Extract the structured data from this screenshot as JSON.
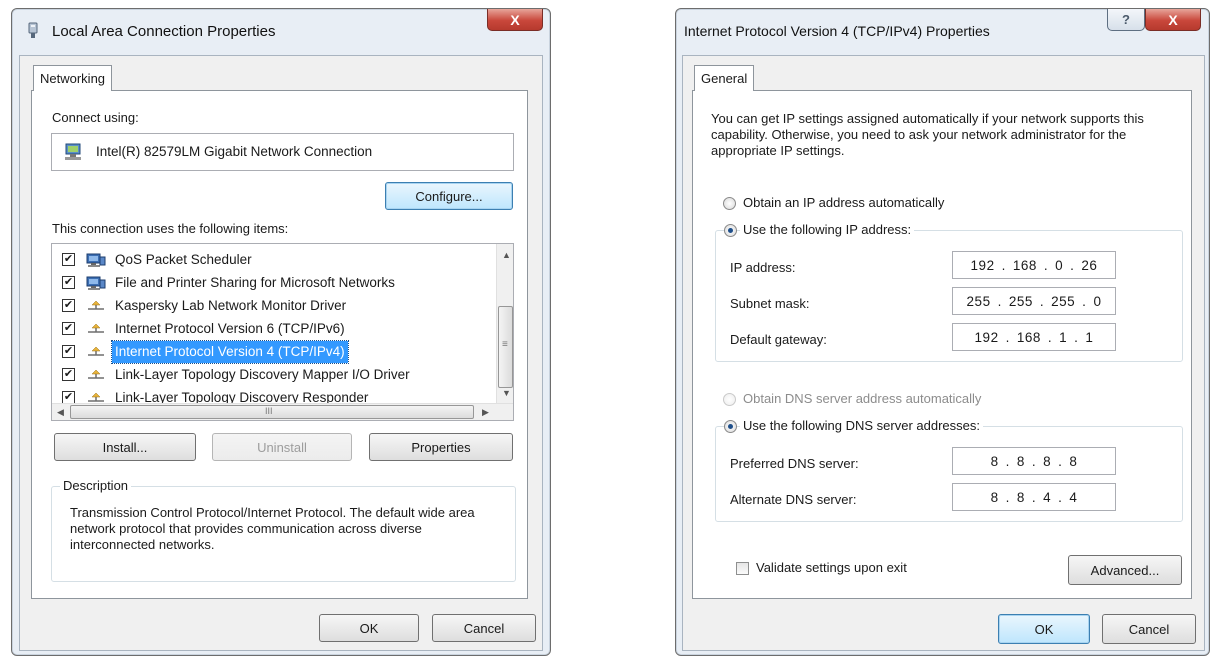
{
  "left_dialog": {
    "title": "Local Area Connection Properties",
    "title_icon": "network-connection-icon",
    "close_glyph": "X",
    "tab": "Networking",
    "connect_using_label": "Connect using:",
    "adapter_name": "Intel(R) 82579LM Gigabit Network Connection",
    "adapter_icon": "network-adapter-icon",
    "configure_button": "Configure...",
    "items_label": "This connection uses the following items:",
    "items": [
      {
        "label": "QoS Packet Scheduler",
        "checked": true,
        "icon": "network-service-icon",
        "selected": false
      },
      {
        "label": "File and Printer Sharing for Microsoft Networks",
        "checked": true,
        "icon": "network-service-icon",
        "selected": false
      },
      {
        "label": "Kaspersky Lab Network Monitor Driver",
        "checked": true,
        "icon": "protocol-icon",
        "selected": false
      },
      {
        "label": "Internet Protocol Version 6 (TCP/IPv6)",
        "checked": true,
        "icon": "protocol-icon",
        "selected": false
      },
      {
        "label": "Internet Protocol Version 4 (TCP/IPv4)",
        "checked": true,
        "icon": "protocol-icon",
        "selected": true
      },
      {
        "label": "Link-Layer Topology Discovery Mapper I/O Driver",
        "checked": true,
        "icon": "protocol-icon",
        "selected": false
      },
      {
        "label": "Link-Layer Topology Discovery Responder",
        "checked": true,
        "icon": "protocol-icon",
        "selected": false
      }
    ],
    "scroll_grip": "≡",
    "hscroll_grip": "III",
    "install_button": "Install...",
    "uninstall_button": "Uninstall",
    "properties_button": "Properties",
    "description_legend": "Description",
    "description_text": "Transmission Control Protocol/Internet Protocol. The default wide area network protocol that provides communication across diverse interconnected networks.",
    "ok_button": "OK",
    "cancel_button": "Cancel"
  },
  "right_dialog": {
    "title": "Internet Protocol Version 4 (TCP/IPv4) Properties",
    "help_glyph": "?",
    "close_glyph": "X",
    "tab": "General",
    "intro_text": "You can get IP settings assigned automatically if your network supports this capability. Otherwise, you need to ask your network administrator for the appropriate IP settings.",
    "obtain_ip_auto": "Obtain an IP address automatically",
    "use_following_ip": "Use the following IP address:",
    "ip_mode": "manual",
    "ip_address_label": "IP address:",
    "ip_address": [
      "192",
      "168",
      "0",
      "26"
    ],
    "subnet_label": "Subnet mask:",
    "subnet_mask": [
      "255",
      "255",
      "255",
      "0"
    ],
    "gateway_label": "Default gateway:",
    "gateway": [
      "192",
      "168",
      "1",
      "1"
    ],
    "obtain_dns_auto": "Obtain DNS server address automatically",
    "use_following_dns": "Use the following DNS server addresses:",
    "dns_mode": "manual",
    "preferred_dns_label": "Preferred DNS server:",
    "preferred_dns": [
      "8",
      "8",
      "8",
      "8"
    ],
    "alternate_dns_label": "Alternate DNS server:",
    "alternate_dns": [
      "8",
      "8",
      "4",
      "4"
    ],
    "validate_label": "Validate settings upon exit",
    "validate_checked": false,
    "advanced_button": "Advanced...",
    "ok_button": "OK",
    "cancel_button": "Cancel"
  },
  "colors": {
    "selection": "#3399ff",
    "close_button": "#c9473b",
    "window_frame": "#e8eef5"
  }
}
